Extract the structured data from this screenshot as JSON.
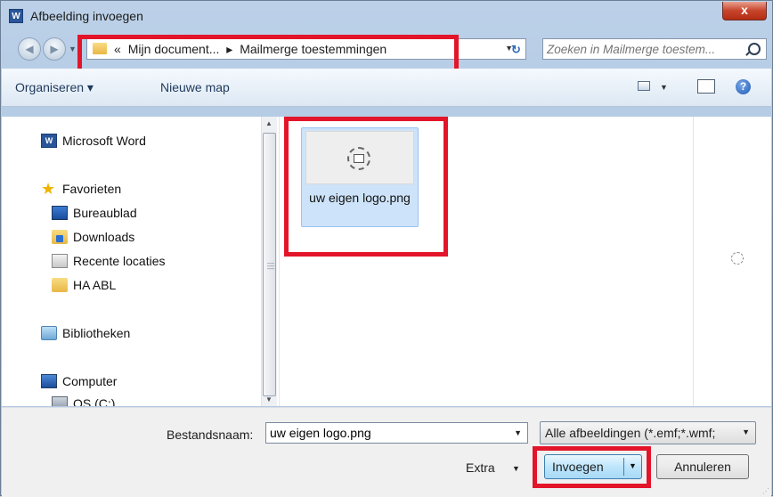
{
  "window": {
    "title": "Afbeelding invoegen",
    "app_icon": "W",
    "close": "x"
  },
  "address": {
    "crumbs": [
      "«",
      "Mijn document...",
      "▸",
      "Mailmerge toestemmingen"
    ]
  },
  "search": {
    "placeholder": "Zoeken in Mailmerge toestem..."
  },
  "toolbar": {
    "organize": "Organiseren ▾",
    "new_folder": "Nieuwe map",
    "help": "?"
  },
  "nav": {
    "word": "Microsoft Word",
    "favorites": "Favorieten",
    "desktop": "Bureaublad",
    "downloads": "Downloads",
    "recent": "Recente locaties",
    "ha_abl": "HA ABL",
    "libraries": "Bibliotheken",
    "computer": "Computer",
    "drive": "OS (C:)"
  },
  "file": {
    "name": "uw eigen logo.png"
  },
  "bottom": {
    "filename_label": "Bestandsnaam:",
    "filename_value": "uw eigen logo.png",
    "filetype": "Alle afbeeldingen (*.emf;*.wmf;",
    "extra": "Extra",
    "insert": "Invoegen",
    "cancel": "Annuleren"
  },
  "colors": {
    "highlight": "#e3152a",
    "selection": "#cde3fa"
  },
  "icons": [
    "word-icon",
    "star-icon",
    "desktop-icon",
    "downloads-folder-icon",
    "recent-places-icon",
    "folder-icon",
    "libraries-icon",
    "computer-icon",
    "drive-icon",
    "search-icon",
    "refresh-icon",
    "help-icon",
    "image-placeholder-icon"
  ]
}
